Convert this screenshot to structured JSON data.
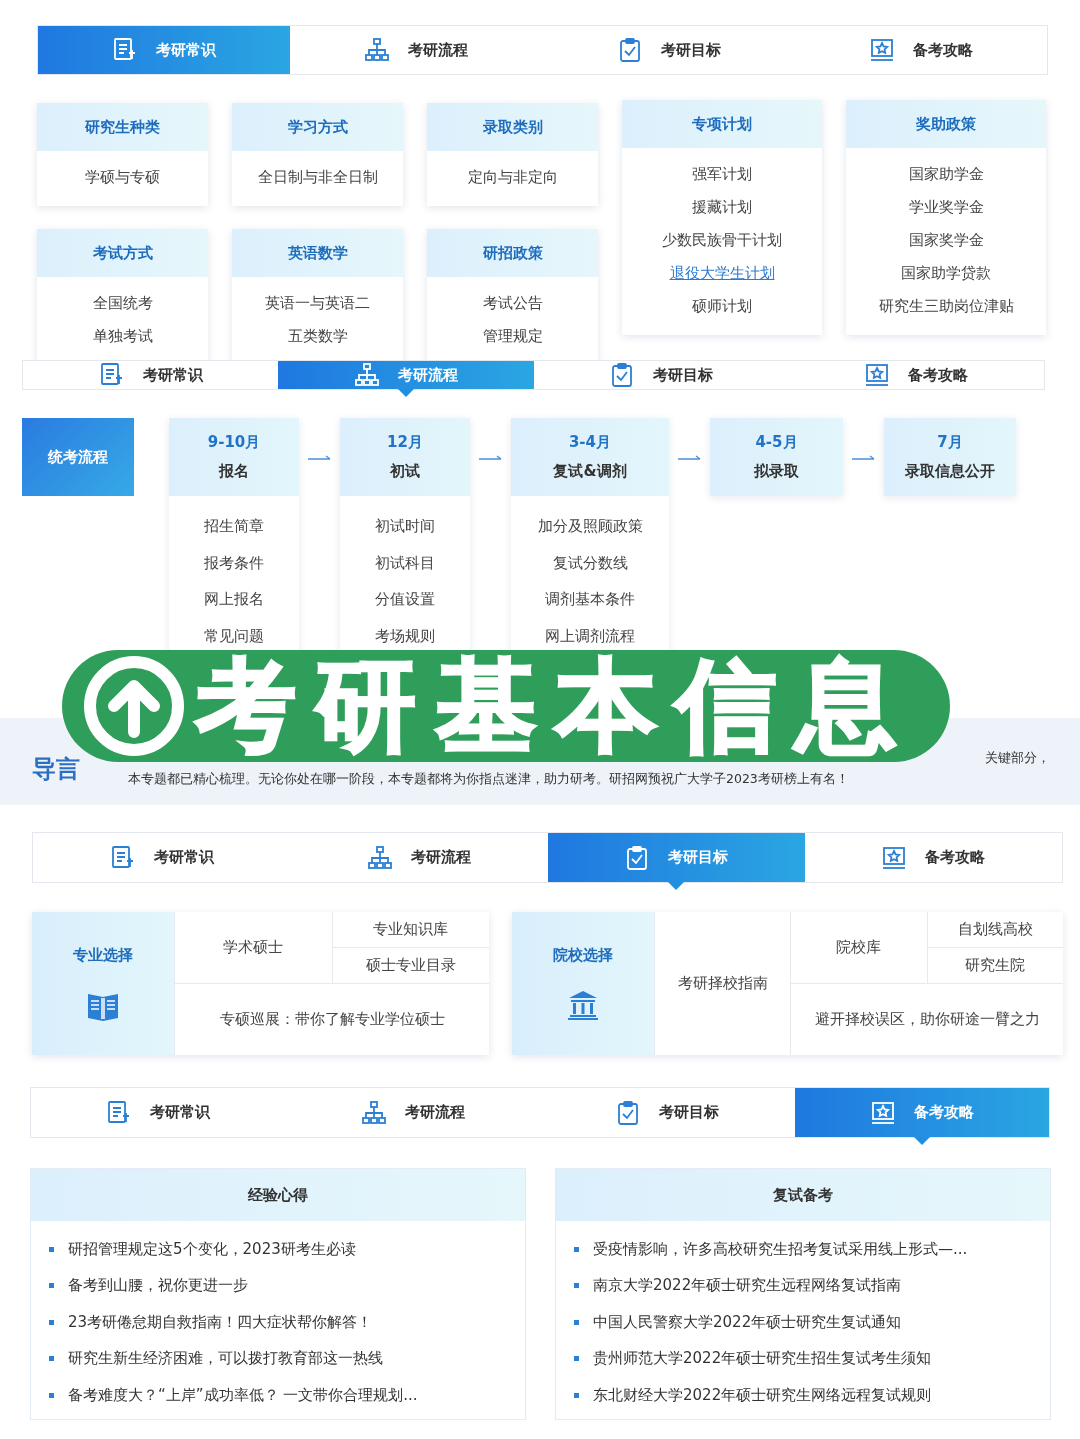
{
  "overlay_title": "考研基本信息",
  "common": {
    "tabs": [
      {
        "label": "考研常识",
        "selected": true
      },
      {
        "label": "考研流程",
        "selected": false
      },
      {
        "label": "考研目标",
        "selected": false
      },
      {
        "label": "备考攻略",
        "selected": false
      }
    ],
    "columns": [
      {
        "cards": [
          {
            "title": "研究生种类",
            "items": [
              {
                "text": "学硕与专硕"
              }
            ]
          },
          {
            "title": "考试方式",
            "items": [
              {
                "text": "全国统考"
              },
              {
                "text": "单独考试"
              }
            ]
          }
        ]
      },
      {
        "cards": [
          {
            "title": "学习方式",
            "items": [
              {
                "text": "全日制与非全日制"
              }
            ]
          },
          {
            "title": "英语数学",
            "items": [
              {
                "text": "英语一与英语二"
              },
              {
                "text": "五类数学"
              }
            ]
          }
        ]
      },
      {
        "cards": [
          {
            "title": "录取类别",
            "items": [
              {
                "text": "定向与非定向"
              }
            ]
          },
          {
            "title": "研招政策",
            "items": [
              {
                "text": "考试公告"
              },
              {
                "text": "管理规定"
              }
            ]
          }
        ]
      },
      {
        "cards": [
          {
            "title": "专项计划",
            "items": [
              {
                "text": "强军计划",
                "link": false
              },
              {
                "text": "援藏计划",
                "link": false
              },
              {
                "text": "少数民族骨干计划",
                "link": false
              },
              {
                "text": "退役大学生计划",
                "link": true
              },
              {
                "text": "硕师计划",
                "link": false
              }
            ]
          }
        ]
      },
      {
        "cards": [
          {
            "title": "奖助政策",
            "items": [
              {
                "text": "国家助学金"
              },
              {
                "text": "学业奖学金"
              },
              {
                "text": "国家奖学金"
              },
              {
                "text": "国家助学贷款"
              },
              {
                "text": "研究生三助岗位津贴"
              }
            ]
          }
        ]
      }
    ]
  },
  "process": {
    "tabs": [
      {
        "label": "考研常识",
        "selected": false
      },
      {
        "label": "考研流程",
        "selected": true
      },
      {
        "label": "考研目标",
        "selected": false
      },
      {
        "label": "备考攻略",
        "selected": false
      }
    ],
    "label": "统考流程",
    "steps": [
      {
        "date": "9-10月",
        "title": "报名",
        "items": [
          "招生简章",
          "报考条件",
          "网上报名",
          "常见问题"
        ]
      },
      {
        "date": "12月",
        "title": "初试",
        "items": [
          "初试时间",
          "初试科目",
          "分值设置",
          "考场规则"
        ]
      },
      {
        "date": "3-4月",
        "title": "复试&调剂",
        "items": [
          "加分及照顾政策",
          "复试分数线",
          "调剂基本条件",
          "网上调剂流程"
        ]
      },
      {
        "date": "4-5月",
        "title": "拟录取"
      },
      {
        "date": "7月",
        "title": "录取信息公开"
      }
    ]
  },
  "intro": {
    "heading": "导言",
    "lines": [
      "关键部分，",
      "本专题都已精心梳理。无论你处在哪一阶段，本专题都将为你指点迷津，助力研考。研招网预祝广大学子2023考研榜上有名！"
    ]
  },
  "goals": {
    "tabs": [
      {
        "label": "考研常识",
        "selected": false
      },
      {
        "label": "考研流程",
        "selected": false
      },
      {
        "label": "考研目标",
        "selected": true
      },
      {
        "label": "备考攻略",
        "selected": false
      }
    ],
    "panels": [
      {
        "label": "专业选择",
        "main": "学术硕士",
        "subs": [
          "专业知识库",
          "硕士专业目录"
        ],
        "footer": "专硕巡展：带你了解专业学位硕士"
      },
      {
        "label": "院校选择",
        "guide": "考研择校指南",
        "main": "院校库",
        "subs": [
          "自划线高校",
          "研究生院"
        ],
        "footer": "避开择校误区，助你研途一臂之力"
      }
    ]
  },
  "strategy": {
    "tabs": [
      {
        "label": "考研常识",
        "selected": false
      },
      {
        "label": "考研流程",
        "selected": false
      },
      {
        "label": "考研目标",
        "selected": false
      },
      {
        "label": "备考攻略",
        "selected": true
      }
    ],
    "lists": [
      {
        "title": "经验心得",
        "items": [
          "研招管理规定这5个变化，2023研考生必读",
          "备考到山腰，祝你更进一步",
          "23考研倦怠期自救指南！四大症状帮你解答！",
          "研究生新生经济困难，可以拨打教育部这一热线",
          "备考难度大？“上岸”成功率低？ 一文带你合理规划..."
        ]
      },
      {
        "title": "复试备考",
        "items": [
          "受疫情影响，许多高校研究生招考复试采用线上形式—...",
          "南京大学2022年硕士研究生远程网络复试指南",
          "中国人民警察大学2022年硕士研究生复试通知",
          "贵州师范大学2022年硕士研究生招生复试考生须知",
          "东北财经大学2022年硕士研究生网络远程复试规则"
        ]
      }
    ]
  }
}
